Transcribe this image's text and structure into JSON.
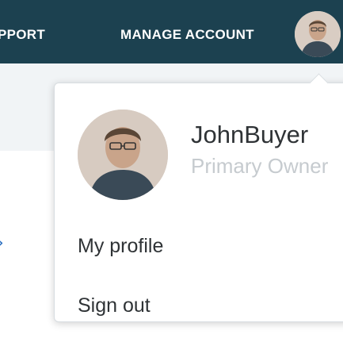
{
  "header": {
    "nav_support": "PPORT",
    "nav_manage_account": "MANAGE ACCOUNT",
    "avatar_icon": "user-avatar"
  },
  "profile_menu": {
    "username": "JohnBuyer",
    "role": "Primary Owner",
    "items": [
      {
        "label": "My profile"
      },
      {
        "label": "Sign out"
      }
    ]
  },
  "colors": {
    "header_bg": "#1c4150",
    "subbar_bg": "#f1f4f6",
    "text_dark": "#2f3336",
    "text_muted": "#c6cbcf",
    "arrow": "#2b6fc0"
  }
}
